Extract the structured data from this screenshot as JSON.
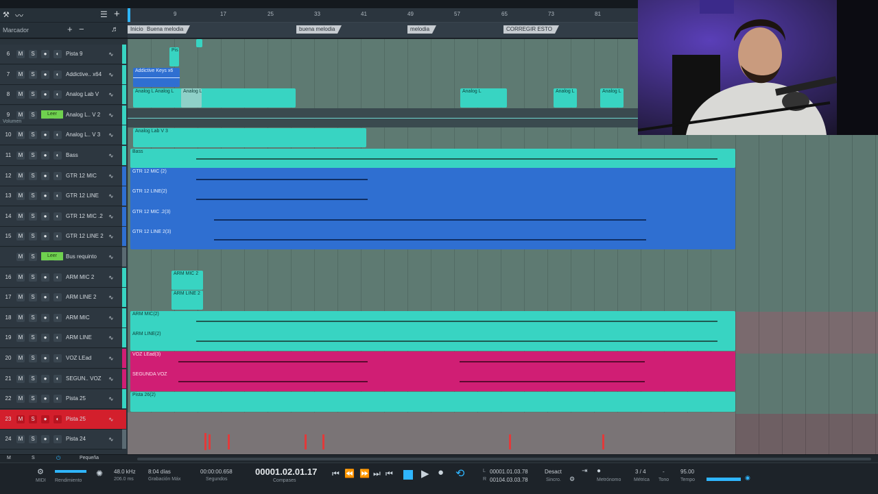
{
  "header": {
    "marker_label": "Marcador",
    "ruler_ticks": [
      "9",
      "17",
      "25",
      "33",
      "41",
      "49",
      "57",
      "65",
      "73",
      "81"
    ],
    "markers": [
      "Inicio",
      "Buena melodia",
      "buena melodia",
      "melodia",
      "CORREGIR ESTO"
    ]
  },
  "tracks": [
    {
      "num": "6",
      "name": "Pista 9",
      "color": "#38d4c2"
    },
    {
      "num": "7",
      "name": "Addictive.. x64",
      "color": "#38d4c2"
    },
    {
      "num": "8",
      "name": "Analog Lab V",
      "color": "#38d4c2"
    },
    {
      "num": "9",
      "name": "Analog L.. V 2",
      "color": "#38d4c2",
      "leer": "Leer",
      "sub": "Volumen"
    },
    {
      "num": "10",
      "name": "Analog L.. V 3",
      "color": "#38d4c2"
    },
    {
      "num": "11",
      "name": "Bass",
      "color": "#38d4c2"
    },
    {
      "num": "12",
      "name": "GTR 12 MIC",
      "color": "#2f6fd1"
    },
    {
      "num": "13",
      "name": "GTR 12 LINE",
      "color": "#2f6fd1"
    },
    {
      "num": "14",
      "name": "GTR 12 MIC .2",
      "color": "#2f6fd1"
    },
    {
      "num": "15",
      "name": "GTR 12 LINE 2",
      "color": "#2f6fd1"
    },
    {
      "num": "",
      "name": "Bus requinto",
      "color": "#5a6a72",
      "leer": "Leer"
    },
    {
      "num": "16",
      "name": "ARM MIC 2",
      "color": "#38d4c2"
    },
    {
      "num": "17",
      "name": "ARM LINE 2",
      "color": "#38d4c2"
    },
    {
      "num": "18",
      "name": "ARM MIC",
      "color": "#38d4c2"
    },
    {
      "num": "19",
      "name": "ARM LINE",
      "color": "#38d4c2"
    },
    {
      "num": "20",
      "name": "VOZ LEad",
      "color": "#d01e74"
    },
    {
      "num": "21",
      "name": "SEGUN.. VOZ",
      "color": "#d01e74"
    },
    {
      "num": "22",
      "name": "Pista 25",
      "color": "#38d4c2"
    },
    {
      "num": "23",
      "name": "Pista 25",
      "color": "#d31f2c",
      "red": true
    },
    {
      "num": "24",
      "name": "Pista 24",
      "color": "#5a6a72"
    }
  ],
  "clips": {
    "pista9": "Pis",
    "addictive": "Addictive Keys x6",
    "analog": "Analog L",
    "analog_run": "Analog L Analog L",
    "lab3": "Analog Lab V 3",
    "bass": "Bass",
    "gtr1": "GTR 12 MIC (2)",
    "gtr2": "GTR 12 LINE(2)",
    "gtr3": "GTR 12 MIC .2(3)",
    "gtr4": "GTR 12 LINE 2(3)",
    "arm1": "ARM MIC 2",
    "arm2": "ARM LINE 2",
    "arm3": "ARM MIC(2)",
    "arm4": "ARM LINE(2)",
    "voz1": "VOZ LEad(3)",
    "voz2": "SEGUNDA VOZ",
    "pista26": "Pista 26(2)"
  },
  "footer": {
    "size_label": "Pequeña",
    "midi": "MIDI",
    "render": "Rendimiento",
    "sample_rate": "48.0 kHz",
    "latency": "206.0 ms",
    "rec_days": "8:04 días",
    "rec_label": "Grabación Máx",
    "seconds": "00:00:00.658",
    "seconds_label": "Segundos",
    "position": "00001.02.01.17",
    "position_label": "Compases",
    "loop_l": "00001.01.03.78",
    "loop_r": "00104.03.03.78",
    "sync_value": "Desact",
    "sync_label": "Sincro.",
    "metronome_label": "Metrónomo",
    "meter": "3 / 4",
    "meter_label": "Métrica",
    "key": "-",
    "key_label": "Tono",
    "tempo": "95.00",
    "tempo_label": "Tempo",
    "l": "L",
    "r": "R"
  }
}
